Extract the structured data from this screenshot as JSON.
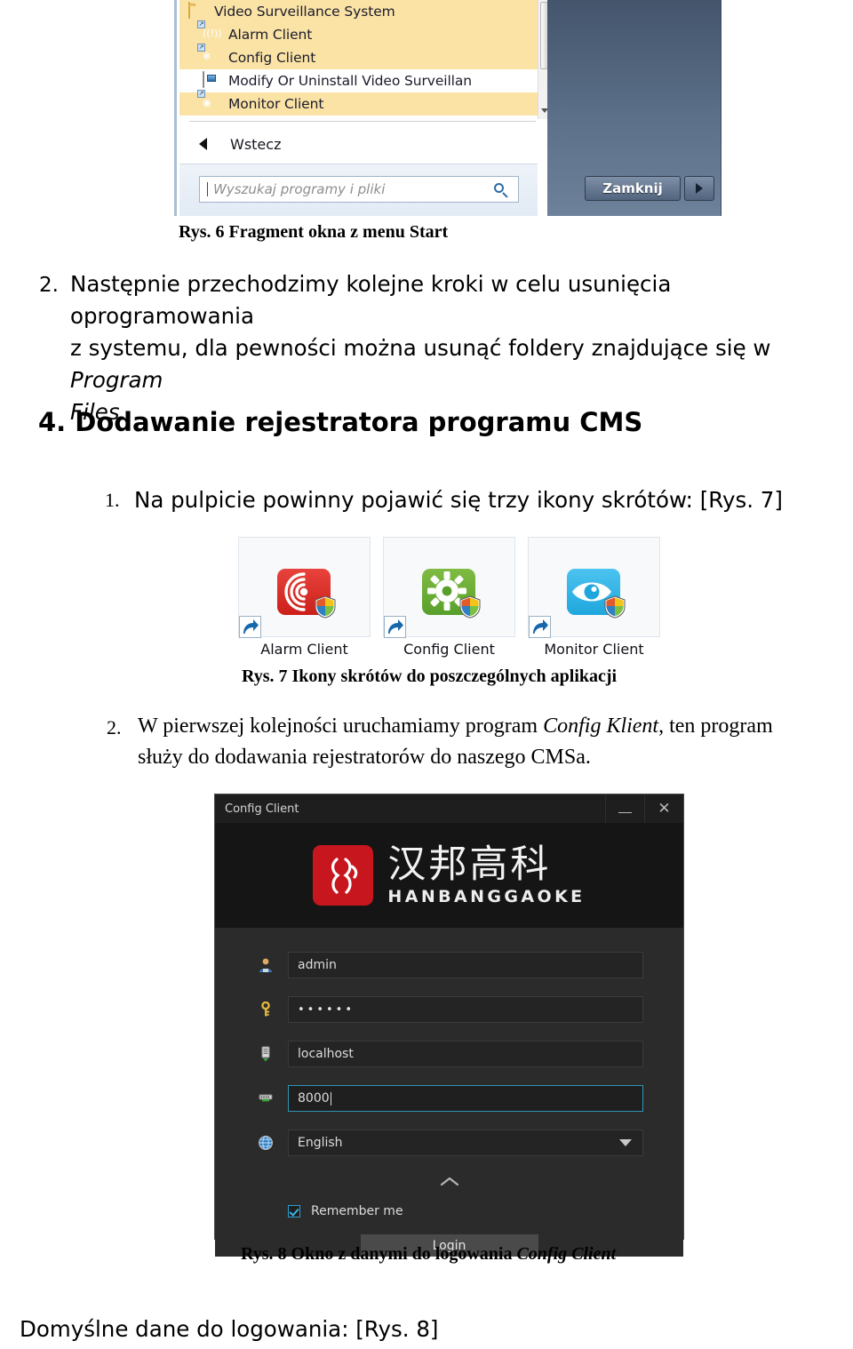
{
  "figure6": {
    "menu_items": [
      {
        "label": "Video Surveillance System",
        "icon": "folder-icon",
        "highlighted": true
      },
      {
        "label": "Alarm Client",
        "icon": "alarm-client-icon",
        "highlighted": true
      },
      {
        "label": "Config Client",
        "icon": "config-client-icon",
        "highlighted": true
      },
      {
        "label": "Modify Or Uninstall Video Surveillan",
        "icon": "installer-icon",
        "highlighted": false
      },
      {
        "label": "Monitor Client",
        "icon": "monitor-client-icon",
        "highlighted": true
      }
    ],
    "back_label": "Wstecz",
    "search_placeholder": "Wyszukaj programy i pliki",
    "shutdown_label": "Zamknij"
  },
  "caption6": {
    "prefix": "Rys. 6 Fragment okna z menu Start"
  },
  "item2": {
    "number": "2.",
    "line1": "Następnie przechodzimy kolejne kroki w celu usunięcia oprogramowania",
    "line2_a": "z systemu, dla pewności można usunąć foldery znajdujące się w ",
    "line2_i": "Program",
    "line3_i": "Files."
  },
  "section4": {
    "heading": "4. Dodawanie rejestratora programu CMS"
  },
  "item1": {
    "number": "1.",
    "text": "Na pulpicie powinny pojawić się trzy ikony skrótów: [Rys. 7]"
  },
  "figure7": {
    "shortcuts": [
      {
        "label": "Alarm Client",
        "color": "#cc1f1a",
        "icon": "alarm-siren-icon"
      },
      {
        "label": "Config Client",
        "color": "#58a02b",
        "icon": "gear-icon"
      },
      {
        "label": "Monitor Client",
        "color": "#1fa7dd",
        "icon": "eye-icon"
      }
    ],
    "badge_icon": "shortcut-arrow-icon",
    "overlay_icon": "uac-shield-icon"
  },
  "caption7": {
    "prefix": "Rys. 7 Ikony skrótów do poszczególnych aplikacji"
  },
  "item2b": {
    "number": "2.",
    "line1_a": "W pierwszej kolejności uruchamiamy program ",
    "line1_i": "Config Klient",
    "line1_b": ", ten program",
    "line2": "służy do dodawania rejestratorów do naszego CMSa."
  },
  "figure8": {
    "window_title": "Config Client",
    "minimize_icon": "minimize-icon",
    "close_icon": "close-icon",
    "brand_cn": "汉邦高科",
    "brand_en": "HANBANGGAOKE",
    "brand_color": "#c7161d",
    "fields": [
      {
        "name": "username",
        "icon": "user-icon",
        "value": "admin",
        "masked": false,
        "focused": false
      },
      {
        "name": "password",
        "icon": "key-icon",
        "value": "••••••",
        "masked": true,
        "focused": false
      },
      {
        "name": "server",
        "icon": "server-icon",
        "value": "localhost",
        "masked": false,
        "focused": false
      },
      {
        "name": "port",
        "icon": "port-icon",
        "value": "8000",
        "masked": false,
        "focused": true
      }
    ],
    "language": {
      "icon": "globe-icon",
      "value": "English"
    },
    "collapse_icon": "chevron-up-icon",
    "remember_label": "Remember me",
    "remember_checked": true,
    "login_label": "Login",
    "focus_color": "#2f96b4"
  },
  "caption8": {
    "a": "Rys. 8 Okno z danymi do logowania ",
    "i": "Config Client"
  },
  "footer": {
    "text": "Domyślne dane do logowania: [Rys. 8]"
  }
}
